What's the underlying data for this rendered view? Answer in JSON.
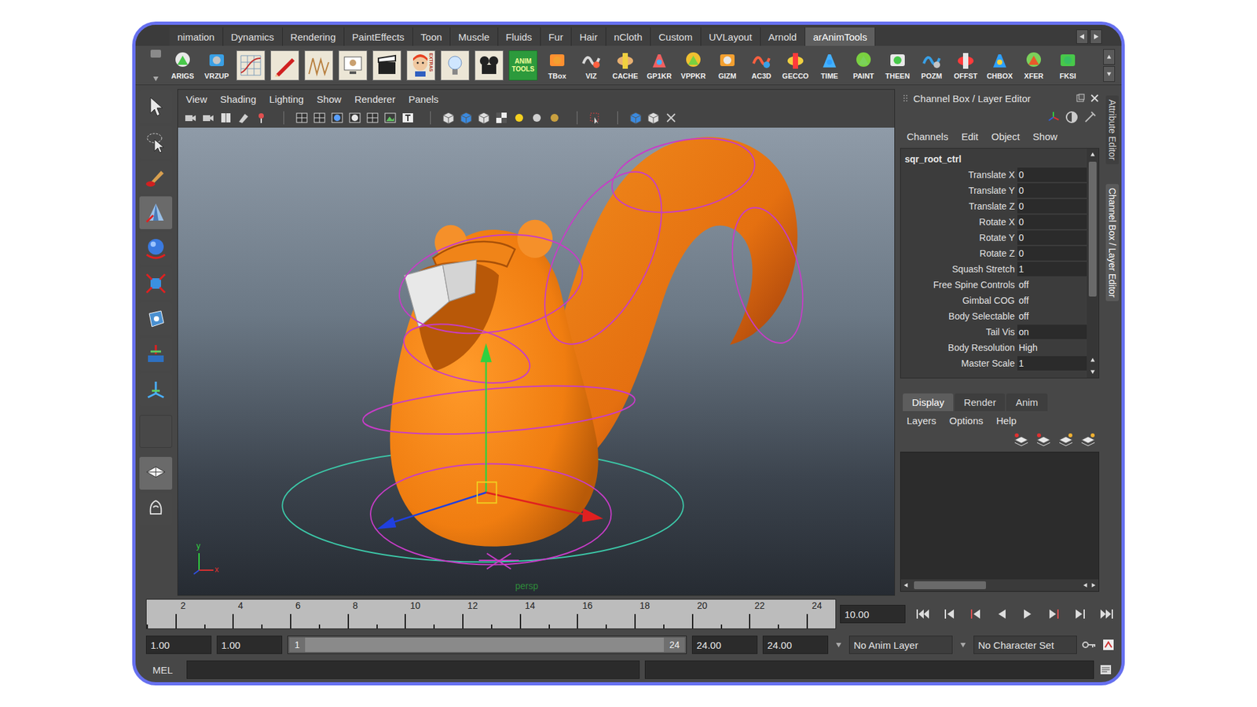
{
  "shelf_tabs": [
    {
      "label": "nimation",
      "selected": false
    },
    {
      "label": "Dynamics",
      "selected": false
    },
    {
      "label": "Rendering",
      "selected": false
    },
    {
      "label": "PaintEffects",
      "selected": false
    },
    {
      "label": "Toon",
      "selected": false
    },
    {
      "label": "Muscle",
      "selected": false
    },
    {
      "label": "Fluids",
      "selected": false
    },
    {
      "label": "Fur",
      "selected": false
    },
    {
      "label": "Hair",
      "selected": false
    },
    {
      "label": "nCloth",
      "selected": false
    },
    {
      "label": "Custom",
      "selected": false
    },
    {
      "label": "UVLayout",
      "selected": false
    },
    {
      "label": "Arnold",
      "selected": false
    },
    {
      "label": "arAnimTools",
      "selected": true
    }
  ],
  "shelf_items": [
    {
      "kind": "labeled",
      "label": "ARIGS"
    },
    {
      "kind": "labeled",
      "label": "VRZUP"
    },
    {
      "kind": "picture"
    },
    {
      "kind": "picture"
    },
    {
      "kind": "picture"
    },
    {
      "kind": "picture"
    },
    {
      "kind": "picture"
    },
    {
      "kind": "badge",
      "label": "EXTRAS"
    },
    {
      "kind": "picture"
    },
    {
      "kind": "picture"
    },
    {
      "kind": "boxed",
      "label": "ANIM TOOLS"
    },
    {
      "kind": "labeled",
      "label": "TBox"
    },
    {
      "kind": "labeled",
      "label": "VIZ"
    },
    {
      "kind": "labeled",
      "label": "CACHE"
    },
    {
      "kind": "labeled",
      "label": "GP1KR"
    },
    {
      "kind": "labeled",
      "label": "VPPKR"
    },
    {
      "kind": "labeled",
      "label": "GIZM"
    },
    {
      "kind": "labeled",
      "label": "AC3D"
    },
    {
      "kind": "labeled",
      "label": "GECCO"
    },
    {
      "kind": "labeled",
      "label": "TIME"
    },
    {
      "kind": "labeled",
      "label": "PAINT"
    },
    {
      "kind": "labeled",
      "label": "THEEN"
    },
    {
      "kind": "labeled",
      "label": "POZM"
    },
    {
      "kind": "labeled",
      "label": "OFFST"
    },
    {
      "kind": "labeled",
      "label": "CHBOX"
    },
    {
      "kind": "labeled",
      "label": "XFER"
    },
    {
      "kind": "labeled",
      "label": "FKSI"
    }
  ],
  "viewport": {
    "menus": [
      "View",
      "Shading",
      "Lighting",
      "Show",
      "Renderer",
      "Panels"
    ],
    "camera": "persp",
    "axis_labels": [
      "y",
      "x"
    ]
  },
  "channel_box": {
    "title": "Channel Box / Layer Editor",
    "menus": [
      "Channels",
      "Edit",
      "Object",
      "Show"
    ],
    "node": "sqr_root_ctrl",
    "attributes": [
      {
        "name": "Translate X",
        "value": "0",
        "kind": "field"
      },
      {
        "name": "Translate Y",
        "value": "0",
        "kind": "field"
      },
      {
        "name": "Translate Z",
        "value": "0",
        "kind": "field"
      },
      {
        "name": "Rotate X",
        "value": "0",
        "kind": "field"
      },
      {
        "name": "Rotate Y",
        "value": "0",
        "kind": "field"
      },
      {
        "name": "Rotate Z",
        "value": "0",
        "kind": "field"
      },
      {
        "name": "Squash Stretch",
        "value": "1",
        "kind": "field"
      },
      {
        "name": "Free Spine Controls",
        "value": "off",
        "kind": "plain"
      },
      {
        "name": "Gimbal COG",
        "value": "off",
        "kind": "plain"
      },
      {
        "name": "Body Selectable",
        "value": "off",
        "kind": "plain"
      },
      {
        "name": "Tail Vis",
        "value": "on",
        "kind": "field"
      },
      {
        "name": "Body Resolution",
        "value": "High",
        "kind": "plain"
      },
      {
        "name": "Master Scale",
        "value": "1",
        "kind": "field"
      }
    ]
  },
  "side_tabs": [
    {
      "label": "Attribute Editor",
      "selected": false
    },
    {
      "label": "Channel Box / Layer Editor",
      "selected": true
    }
  ],
  "layer_editor": {
    "tabs": [
      {
        "label": "Display",
        "selected": true
      },
      {
        "label": "Render",
        "selected": false
      },
      {
        "label": "Anim",
        "selected": false
      }
    ],
    "menus": [
      "Layers",
      "Options",
      "Help"
    ]
  },
  "time_slider": {
    "tick_labels": [
      "2",
      "4",
      "6",
      "8",
      "10",
      "12",
      "14",
      "16",
      "18",
      "20",
      "22",
      "24"
    ],
    "current_time": "10.00"
  },
  "range_slider": {
    "start": "1.00",
    "playback_start": "1.00",
    "bar_start": "1",
    "bar_end": "24",
    "playback_end": "24.00",
    "end": "24.00",
    "anim_layer": "No Anim Layer",
    "character_set": "No Character Set"
  },
  "command_line": {
    "label": "MEL"
  }
}
